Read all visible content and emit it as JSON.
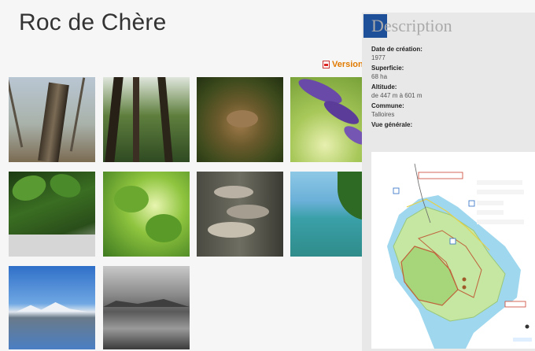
{
  "page": {
    "title": "Roc de Chère"
  },
  "download": {
    "label": "Version",
    "icon": "pdf-icon"
  },
  "gallery": {
    "photos": [
      {
        "name": "photo-dead-tree-trunk"
      },
      {
        "name": "photo-forest-trees"
      },
      {
        "name": "photo-frog"
      },
      {
        "name": "photo-purple-flowers"
      },
      {
        "name": "photo-green-leaves"
      },
      {
        "name": "photo-backlit-leaves"
      },
      {
        "name": "photo-bracket-fungi"
      },
      {
        "name": "photo-lake-shore"
      },
      {
        "name": "photo-lake-mountains"
      },
      {
        "name": "photo-lake-clouds"
      }
    ]
  },
  "description": {
    "title": "Description",
    "fields": [
      {
        "label": "Date de création:",
        "value": "1977"
      },
      {
        "label": "Superficie:",
        "value": "68 ha"
      },
      {
        "label": "Altitude:",
        "value": "de 447 m à 601 m"
      },
      {
        "label": "Commune:",
        "value": "Talloires"
      }
    ],
    "overview_label": "Vue générale:"
  },
  "colors": {
    "accent": "#1e4f99",
    "link": "#e07a00",
    "panel": "#e8e8e8"
  }
}
